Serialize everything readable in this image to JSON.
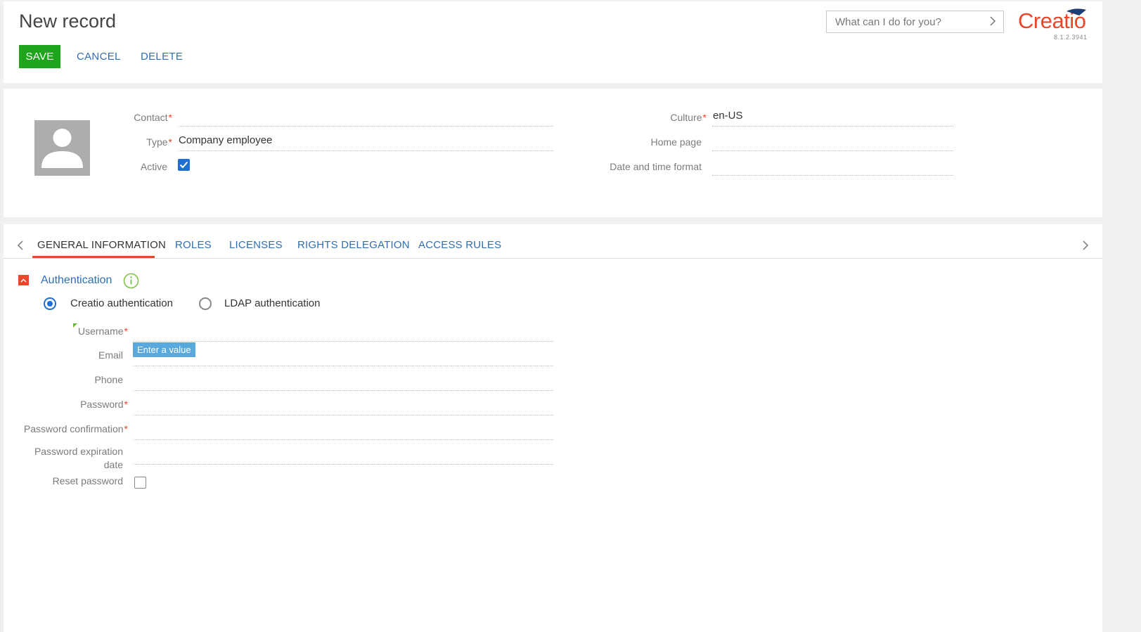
{
  "header": {
    "title": "New record",
    "save_label": "SAVE",
    "cancel_label": "CANCEL",
    "delete_label": "DELETE",
    "search_placeholder": "What can I do for you?",
    "logo_text": "Creatio",
    "version": "8.1.2.3941"
  },
  "profile": {
    "contact_label": "Contact",
    "contact_value": "",
    "type_label": "Type",
    "type_value": "Company employee",
    "active_label": "Active",
    "active_checked": true,
    "culture_label": "Culture",
    "culture_value": "en-US",
    "homepage_label": "Home page",
    "homepage_value": "",
    "datetime_label": "Date and time format",
    "datetime_value": ""
  },
  "tabs": [
    {
      "label": "GENERAL INFORMATION",
      "active": true
    },
    {
      "label": "ROLES",
      "active": false
    },
    {
      "label": "LICENSES",
      "active": false
    },
    {
      "label": "RIGHTS DELEGATION",
      "active": false
    },
    {
      "label": "ACCESS RULES",
      "active": false
    }
  ],
  "auth": {
    "group_title": "Authentication",
    "radio_creatio": "Creatio authentication",
    "radio_ldap": "LDAP authentication",
    "selected": "creatio",
    "username_label": "Username",
    "email_label": "Email",
    "email_hint": "Enter a value",
    "phone_label": "Phone",
    "password_label": "Password",
    "password_confirm_label": "Password confirmation",
    "pwd_expiration_line1": "Password expiration",
    "pwd_expiration_line2": "date",
    "reset_password_label": "Reset password",
    "reset_password_checked": false
  },
  "colors": {
    "accent_blue": "#2f6eb5",
    "save_green": "#1fa51c",
    "brand_orange": "#e9462a",
    "checkbox_blue": "#1f6fd1",
    "hint_blue": "#5aa9dc"
  }
}
